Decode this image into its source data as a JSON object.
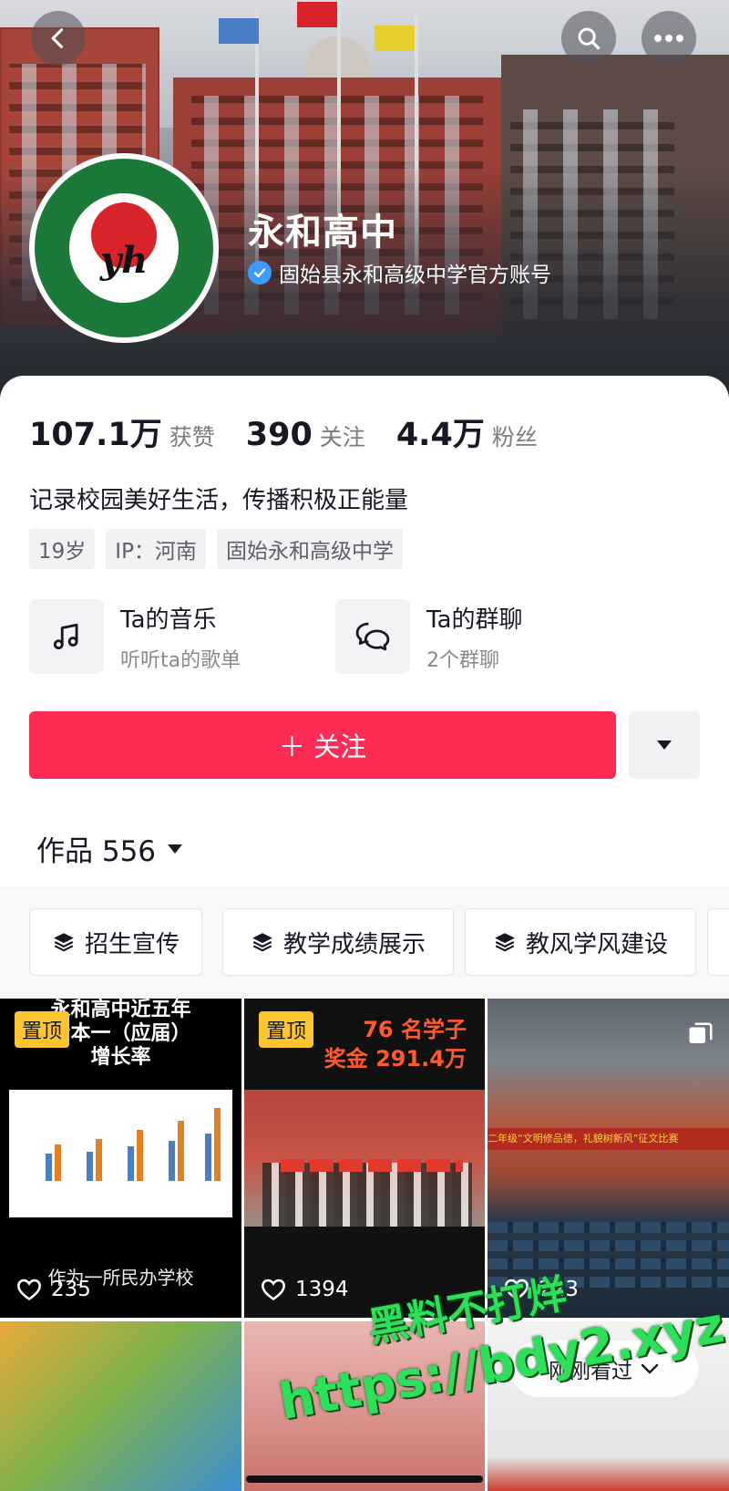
{
  "header": {
    "back_icon": "chevron-left-icon",
    "search_icon": "search-icon",
    "more_icon": "ellipsis-icon"
  },
  "profile": {
    "avatar_text": "yh",
    "name": "永和高中",
    "verified_text": "固始县永和高级中学官方账号"
  },
  "stats": [
    {
      "value": "107.1万",
      "label": "获赞"
    },
    {
      "value": "390",
      "label": "关注"
    },
    {
      "value": "4.4万",
      "label": "粉丝"
    }
  ],
  "bio": "记录校园美好生活，传播积极正能量",
  "tags": [
    "19岁",
    "IP：河南",
    "固始永和高级中学"
  ],
  "features": [
    {
      "title": "Ta的音乐",
      "subtitle": "听听ta的歌单",
      "icon": "music-note-icon"
    },
    {
      "title": "Ta的群聊",
      "subtitle": "2个群聊",
      "icon": "chat-bubbles-icon"
    }
  ],
  "follow_label": "＋ 关注",
  "works_label": "作品 556",
  "collections": [
    "招生宣传",
    "教学成绩展示",
    "教风学风建设"
  ],
  "videos": [
    {
      "pinned": "置顶",
      "likes": "235",
      "title_text": "永和高中近五年\n考本一（应届）\n增长率",
      "caption": "作为一所民办学校"
    },
    {
      "pinned": "置顶",
      "likes": "1394",
      "title_text": "76 名学子\n奖金 291.4万"
    },
    {
      "likes": "223",
      "banner": "二年级“文明修品德，礼貌树新风”征文比赛"
    }
  ],
  "recent_label": "刚刚看过",
  "watermark": {
    "line1": "黑料不打烊",
    "line2": "https://bdy2.xyz"
  },
  "colors": {
    "accent": "#fe2c55",
    "pin": "#fbc531",
    "verified": "#3b9cff"
  }
}
